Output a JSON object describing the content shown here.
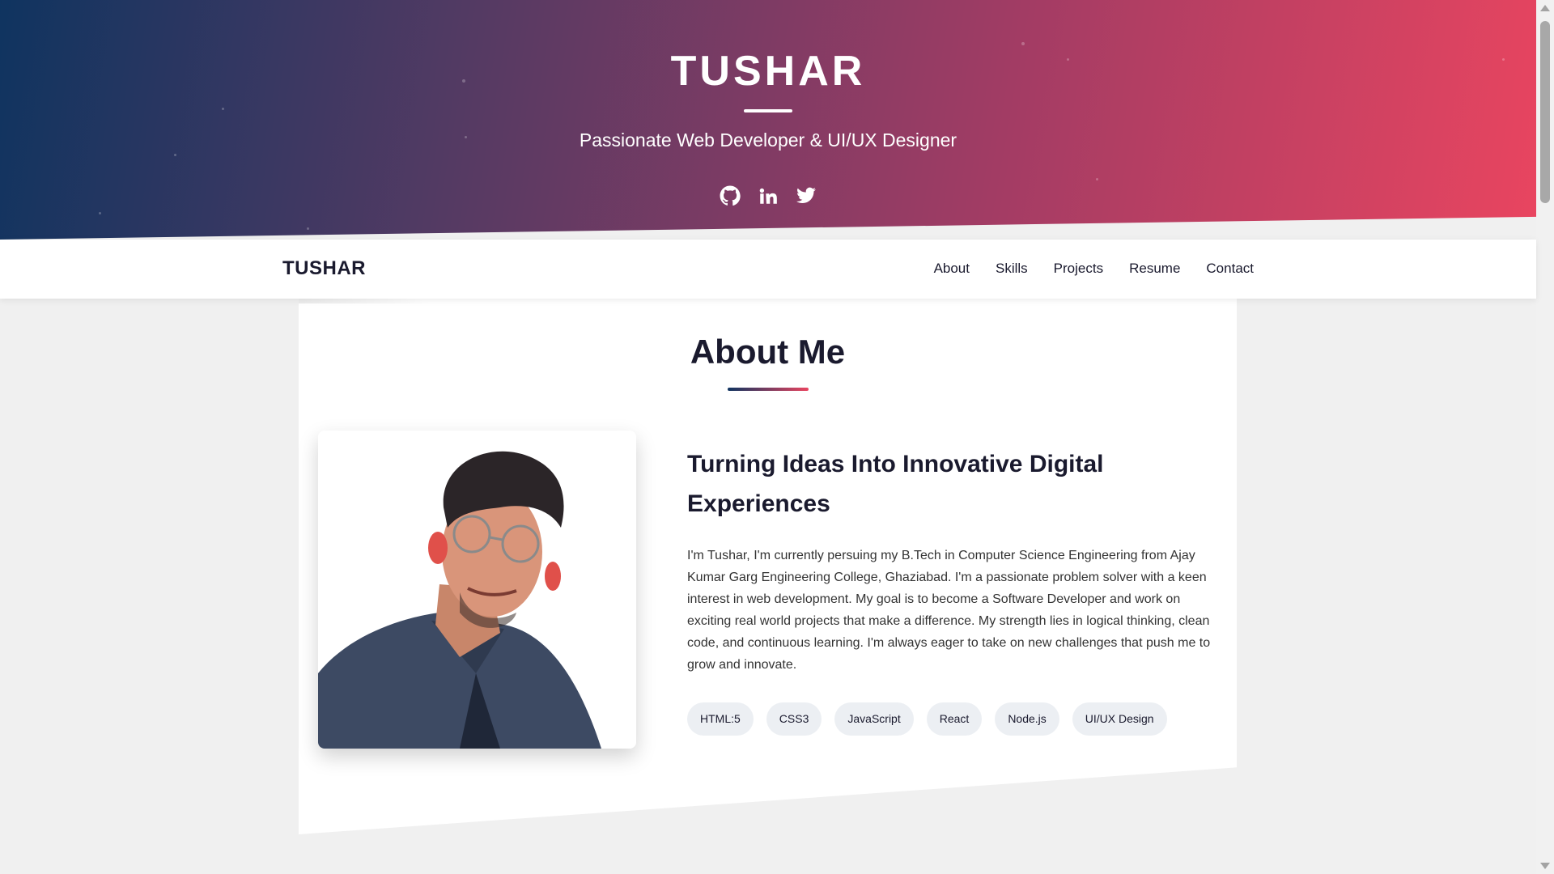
{
  "hero": {
    "title": "TUSHAR",
    "subtitle": "Passionate Web Developer & UI/UX Designer",
    "socials": [
      "github-icon",
      "linkedin-icon",
      "twitter-icon"
    ],
    "gradient": [
      "#0f3460",
      "#e94560"
    ]
  },
  "navbar": {
    "brand": "TUSHAR",
    "links": [
      "About",
      "Skills",
      "Projects",
      "Resume",
      "Contact"
    ]
  },
  "about": {
    "title": "About Me",
    "heading": "Turning Ideas Into Innovative Digital Experiences",
    "paragraph": "I'm Tushar, I'm currently persuing my B.Tech in Computer Science Engineering from Ajay Kumar Garg Engineering College, Ghaziabad. I'm a passionate problem solver with a keen interest in web development. My goal is to become a Software Developer and work on exciting real world projects that make a difference. My strength lies in logical thinking, clean code, and continuous learning. I'm always eager to take on new challenges that push me to grow and innovate.",
    "tags": [
      "HTML:5",
      "CSS3",
      "JavaScript",
      "React",
      "Node.js",
      "UI/UX Design"
    ]
  },
  "colors": {
    "accent_dark": "#0f3460",
    "accent_red": "#e94560",
    "text_dark": "#1a1a2e"
  }
}
